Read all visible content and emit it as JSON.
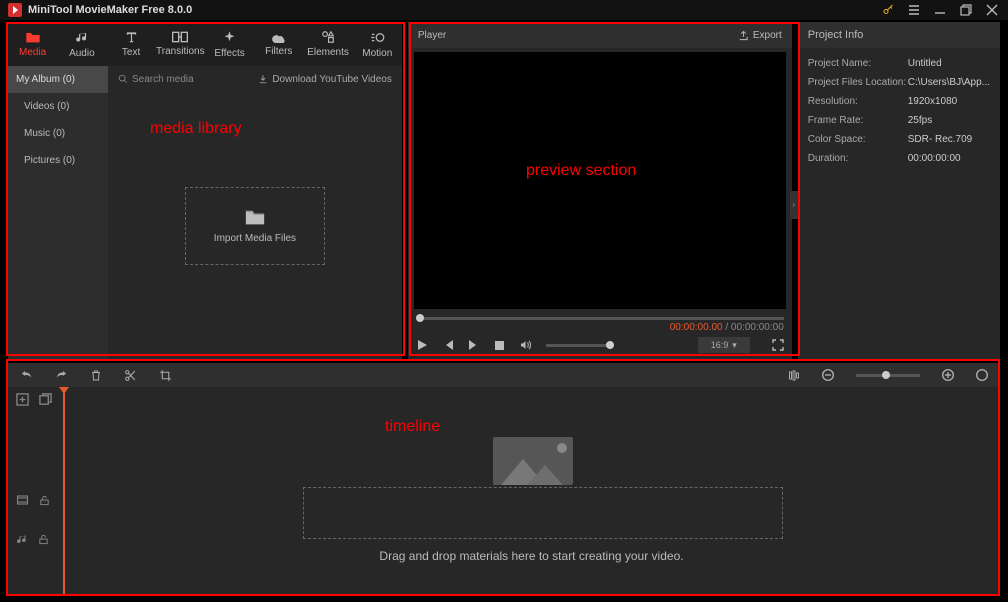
{
  "app": {
    "title": "MiniTool MovieMaker Free 8.0.0",
    "logo_letter": null
  },
  "media_tabs": [
    {
      "label": "Media",
      "icon": "folder-icon",
      "active": true
    },
    {
      "label": "Audio",
      "icon": "music-note-icon",
      "active": false
    },
    {
      "label": "Text",
      "icon": "text-icon",
      "active": false
    },
    {
      "label": "Transitions",
      "icon": "transition-icon",
      "active": false
    },
    {
      "label": "Effects",
      "icon": "sparkle-icon",
      "active": false
    },
    {
      "label": "Filters",
      "icon": "cloud-icon",
      "active": false
    },
    {
      "label": "Elements",
      "icon": "element-icon",
      "active": false
    },
    {
      "label": "Motion",
      "icon": "motion-icon",
      "active": false
    }
  ],
  "albums": [
    {
      "label": "My Album (0)",
      "selected": true
    },
    {
      "label": "Videos (0)"
    },
    {
      "label": "Music (0)"
    },
    {
      "label": "Pictures (0)"
    }
  ],
  "media_toolbar": {
    "search_placeholder": "Search media",
    "download_label": "Download YouTube Videos"
  },
  "import_label": "Import Media Files",
  "player": {
    "title": "Player",
    "export_label": "Export",
    "time_current": "00:00:00.00",
    "time_total": "00:00:00:00",
    "aspect_label": "16:9"
  },
  "info": {
    "title": "Project Info",
    "rows": [
      {
        "k": "Project Name:",
        "v": "Untitled"
      },
      {
        "k": "Project Files Location:",
        "v": "C:\\Users\\BJ\\App..."
      },
      {
        "k": "Resolution:",
        "v": "1920x1080"
      },
      {
        "k": "Frame Rate:",
        "v": "25fps"
      },
      {
        "k": "Color Space:",
        "v": "SDR- Rec.709"
      },
      {
        "k": "Duration:",
        "v": "00:00:00:00"
      }
    ]
  },
  "timeline": {
    "drop_text": "Drag and drop materials here to start creating your video."
  },
  "annotations": {
    "media_library": "media library",
    "preview": "preview section",
    "timeline": "timeline"
  }
}
